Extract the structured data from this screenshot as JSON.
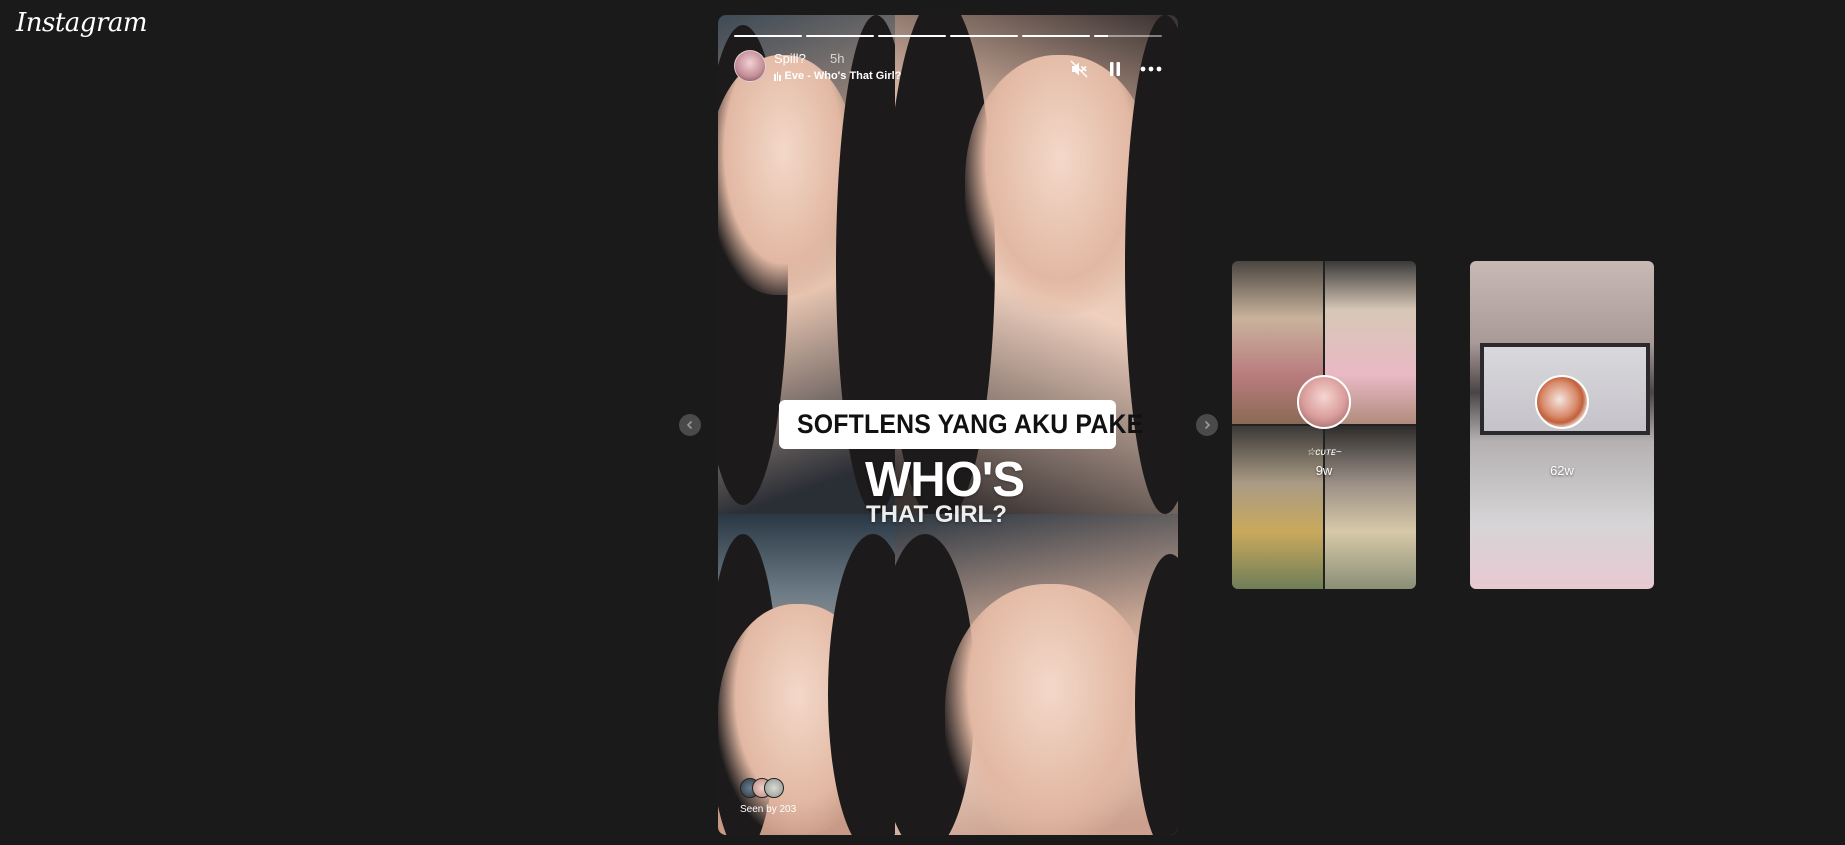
{
  "app": {
    "logo": "Instagram"
  },
  "story": {
    "username": "Spill?",
    "time": "5h",
    "music": "Eve - Who's That Girl?",
    "segments": [
      1,
      1,
      1,
      1,
      1,
      0.2
    ],
    "link_sticker": "SOFTLENS YANG AKU PAKE",
    "overlay_title": "WHO'S",
    "overlay_subtitle": "THAT GIRL?",
    "seen_by": "Seen by 203",
    "icons": {
      "mute": "speaker-muted-icon",
      "pause": "pause-icon",
      "more": "more-horizontal-icon",
      "link": "link-icon",
      "music": "music-bars-icon"
    }
  },
  "previews": [
    {
      "time": "9w",
      "deco": "☆ᴄᴜᴛᴇ~"
    },
    {
      "time": "62w",
      "deco": ""
    }
  ],
  "navigation": {
    "prev_icon": "chevron-left-icon",
    "next_icon": "chevron-right-icon"
  },
  "colors": {
    "background": "#1a1a1a",
    "link_gradient_start": "#f9a23b",
    "link_gradient_end": "#c52ec9",
    "nav_button": "#4a4a4a"
  }
}
